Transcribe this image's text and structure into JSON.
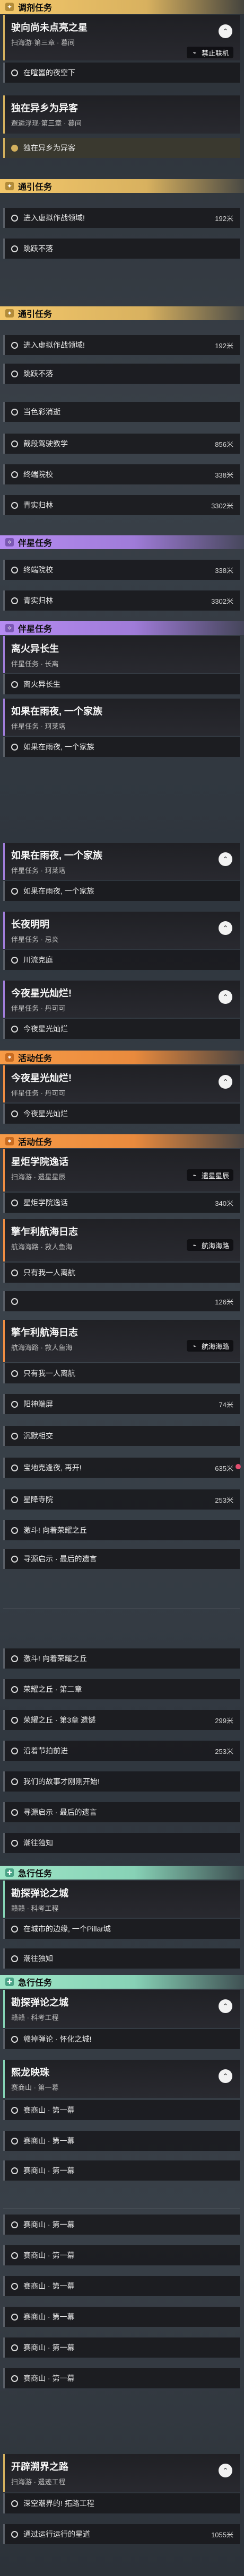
{
  "segments": [
    {
      "label": "调剂任务",
      "color": "y"
    },
    {
      "label": "通引任务",
      "color": "y"
    },
    {
      "label": "通引任务",
      "color": "y"
    },
    {
      "label": "伴星任务",
      "color": "purple"
    },
    {
      "label": "伴星任务",
      "color": "purple"
    },
    {
      "label": "活动任务",
      "color": "orange"
    },
    {
      "label": "活动任务",
      "color": "orange"
    },
    {
      "label": "急行任务",
      "color": "teal"
    },
    {
      "label": "急行任务",
      "color": "teal"
    }
  ],
  "top_card": {
    "title": "驶向尚未点亮之星",
    "sub": "扫海游·第三章 · 暮间",
    "tag": "禁止联机"
  },
  "top_objective": "在喧嚣的夜空下",
  "card2": {
    "title": "独在异乡为异客",
    "sub": "邂逅浮现·第三章 · 暮间"
  },
  "card2_obj": "独在异乡为异客",
  "group1": [
    {
      "text": "进入虚拟作战领域!",
      "dist": "192米"
    },
    {
      "text": "跳跃不落",
      "dist": ""
    }
  ],
  "group2": [
    {
      "text": "进入虚拟作战领域!",
      "dist": "192米"
    },
    {
      "text": "跳跃不落",
      "dist": ""
    },
    {
      "text": "当色彩消逝",
      "dist": ""
    },
    {
      "text": "截段驾驶教学",
      "dist": "856米"
    },
    {
      "text": "终端院校",
      "dist": "338米"
    },
    {
      "text": "青实归林",
      "dist": "3302米"
    }
  ],
  "group3": [
    {
      "text": "终端院校",
      "dist": "338米"
    },
    {
      "text": "青实归林",
      "dist": "3302米"
    }
  ],
  "card_companion1": {
    "title": "离火异长生",
    "sub": "伴星任务 · 长离"
  },
  "card_companion1_obj": "离火异长生",
  "card_companion2": {
    "title": "如果在雨夜, 一个家族",
    "sub": "伴星任务 · 珂莱塔"
  },
  "card_companion2_obj": "如果在雨夜, 一个家族",
  "card_companion3": {
    "title": "如果在雨夜, 一个家族",
    "sub": "伴星任务 · 珂莱塔"
  },
  "card_companion3_obj": "如果在雨夜, 一个家族",
  "card_companion4": {
    "title": "长夜明明",
    "sub": "伴星任务 · 忌炎"
  },
  "card_companion4_obj": "川流克庭",
  "card_companion5": {
    "title": "今夜星光灿烂!",
    "sub": "伴星任务 · 丹可可"
  },
  "card_companion5_obj": "今夜星光灿烂",
  "card_companion6": {
    "title": "今夜星光灿烂!",
    "sub": "伴星任务 · 丹可可"
  },
  "card_companion6_obj": "今夜星光灿烂",
  "card_event1": {
    "title": "星炬学院逸话",
    "sub": "扫海游 · 遗星星辰",
    "tag": "遗星星辰"
  },
  "card_event1_obj": {
    "text": "星炬学院逸话",
    "dist": "340米"
  },
  "card_event2": {
    "title": "擎乍利航海日志",
    "sub": "航海海路 · 救人鱼海",
    "tag": "航海海路"
  },
  "card_event2_obj": {
    "text": "只有我一人离航",
    "dist": ""
  },
  "card_event2_obj2": {
    "text": "",
    "dist": "126米"
  },
  "card_event3": {
    "title": "擎乍利航海日志",
    "sub": "航海海路 · 救人鱼海",
    "tag": "航海海路"
  },
  "group4": [
    {
      "text": "只有我一人离航",
      "dist": ""
    },
    {
      "text": "阳神端屏",
      "dist": "74米"
    },
    {
      "text": "沉默相交",
      "dist": ""
    },
    {
      "text": "宝地克逢夜, 再开!",
      "dist": "635米"
    },
    {
      "text": "星降寺院",
      "dist": "253米"
    },
    {
      "text": "激斗! 向着荣耀之丘",
      "dist": ""
    },
    {
      "text": "寻源启示 · 最后的遗言",
      "dist": ""
    }
  ],
  "group5": [
    {
      "text": "激斗! 向着荣耀之丘",
      "dist": ""
    },
    {
      "text": "荣耀之丘 · 第二章",
      "dist": ""
    },
    {
      "text": "荣耀之丘 · 第3章 遗憾",
      "dist": "299米"
    },
    {
      "text": "沿着节拍前进",
      "dist": "253米"
    },
    {
      "text": "我们的故事才刚刚开始!",
      "dist": ""
    },
    {
      "text": "寻源启示 · 最后的遗言",
      "dist": ""
    },
    {
      "text": "潮往独知",
      "dist": ""
    }
  ],
  "card_rush1": {
    "title": "勘探弹论之城",
    "sub": "赣赣 · 科考工程"
  },
  "card_rush1_obj": "在城市的边缘, 一个Pillar城",
  "card_rush1_obj2": "潮往独知",
  "card_rush2": {
    "title": "勘探弹论之城",
    "sub": "赣赣 · 科考工程"
  },
  "card_rush2_obj": "赣掉弹论 · 怀化之城!",
  "card_rush3": {
    "title": "熙龙映珠",
    "sub": "赛商山 · 第一幕"
  },
  "group6": [
    {
      "text": "赛商山 · 第一幕",
      "dist": ""
    },
    {
      "text": "赛商山 · 第一幕",
      "dist": ""
    },
    {
      "text": "赛商山 · 第一幕",
      "dist": ""
    }
  ],
  "group7": [
    {
      "text": "赛商山 · 第一幕",
      "dist": ""
    },
    {
      "text": "赛商山 · 第一幕",
      "dist": ""
    },
    {
      "text": "赛商山 · 第一幕",
      "dist": ""
    },
    {
      "text": "赛商山 · 第一幕",
      "dist": ""
    },
    {
      "text": "赛商山 · 第一幕",
      "dist": ""
    },
    {
      "text": "赛商山 · 第一幕",
      "dist": ""
    }
  ],
  "card_final": {
    "title": "开辟溯界之路",
    "sub": "扫海游 · 遗迹工程"
  },
  "card_final_obj1": {
    "text": "深空潮界的! 拓路工程",
    "dist": ""
  },
  "card_final_obj2": {
    "text": "通过运行运行的星道",
    "dist": "1055米"
  },
  "icons": {
    "chevron": "chevron-up-icon",
    "circle": "objective-circle-icon",
    "tag": "network-icon"
  }
}
